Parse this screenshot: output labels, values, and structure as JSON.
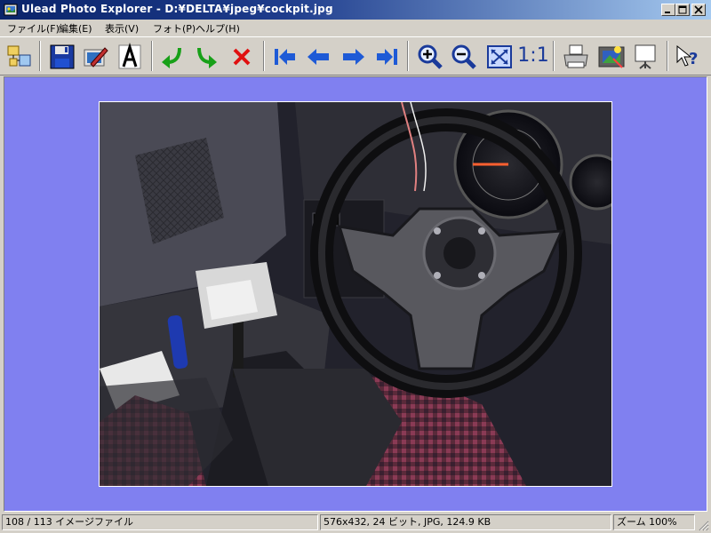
{
  "window": {
    "title": "Ulead Photo Explorer - D:¥DELTA¥jpeg¥cockpit.jpg"
  },
  "menu": {
    "items": [
      {
        "label": "ファイル(F)"
      },
      {
        "label": "編集(E)"
      },
      {
        "label": "表示(V)"
      },
      {
        "label": "フォト(P)"
      },
      {
        "label": "ヘルプ(H)"
      }
    ]
  },
  "toolbar": {
    "buttons": [
      {
        "icon": "browse-icon"
      },
      {
        "icon": "save-icon"
      },
      {
        "icon": "edit-icon"
      },
      {
        "icon": "text-icon"
      },
      {
        "icon": "rotate-left-icon"
      },
      {
        "icon": "rotate-right-icon"
      },
      {
        "icon": "delete-icon"
      },
      {
        "icon": "first-icon"
      },
      {
        "icon": "previous-icon"
      },
      {
        "icon": "next-icon"
      },
      {
        "icon": "last-icon"
      },
      {
        "icon": "zoom-in-icon"
      },
      {
        "icon": "zoom-out-icon"
      },
      {
        "icon": "fit-window-icon"
      },
      {
        "icon": "actual-size-icon"
      },
      {
        "icon": "print-icon"
      },
      {
        "icon": "slideshow-icon"
      },
      {
        "icon": "presentation-icon"
      },
      {
        "icon": "context-help-icon"
      }
    ],
    "actual_size_label": "1:1"
  },
  "colors": {
    "viewer_background": "#8080f0",
    "title_gradient_start": "#0a246a",
    "title_gradient_end": "#a6caf0"
  },
  "statusbar": {
    "position": "108 / 113 イメージファイル",
    "image_info": "576x432, 24 ビット, JPG, 124.9 KB",
    "zoom": "ズーム 100%"
  }
}
